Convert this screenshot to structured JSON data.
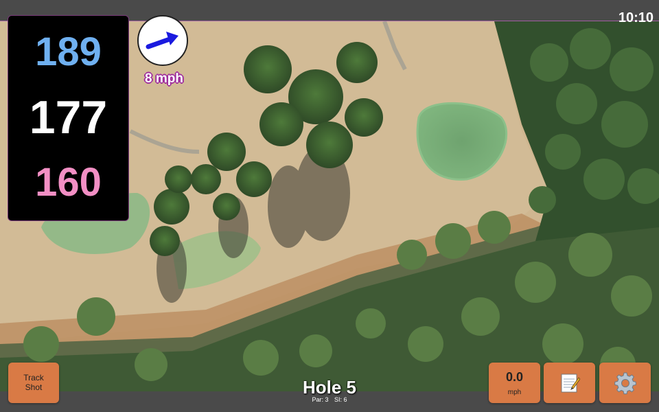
{
  "status": {
    "time": "10:10"
  },
  "distances": {
    "back": "189",
    "center": "177",
    "front": "160",
    "colors": {
      "back": "#6fb0f0",
      "center": "#ffffff",
      "front": "#f28fc4"
    }
  },
  "wind": {
    "speed_label": "8 mph",
    "icon": "wind-direction-arrow-icon",
    "arrow_color": "#1a1adf"
  },
  "buttons": {
    "track_shot": {
      "line1": "Track",
      "line2": "Shot"
    },
    "speed": {
      "value": "0.0",
      "unit": "mph"
    },
    "notes": {
      "icon": "notepad-icon"
    },
    "settings": {
      "icon": "gear-icon"
    },
    "color": "#d97a45"
  },
  "hole": {
    "title": "Hole 5",
    "par": "Par: 3",
    "si": "SI: 6"
  }
}
